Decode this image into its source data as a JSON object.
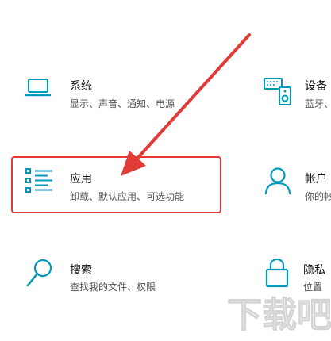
{
  "tiles": {
    "system": {
      "title": "系统",
      "desc": "显示、声音、通知、电源"
    },
    "devices": {
      "title": "设备",
      "desc": "蓝牙、打"
    },
    "apps": {
      "title": "应用",
      "desc": "卸载、默认应用、可选功能"
    },
    "accounts": {
      "title": "帐户",
      "desc": "你的帐户"
    },
    "search": {
      "title": "搜索",
      "desc": "查找我的文件、权限"
    },
    "privacy": {
      "title": "隐私",
      "desc": "位置"
    }
  },
  "colors": {
    "accent": "#0099bc",
    "highlight": "#e03b36"
  },
  "watermark": {
    "text": "下载吧"
  }
}
